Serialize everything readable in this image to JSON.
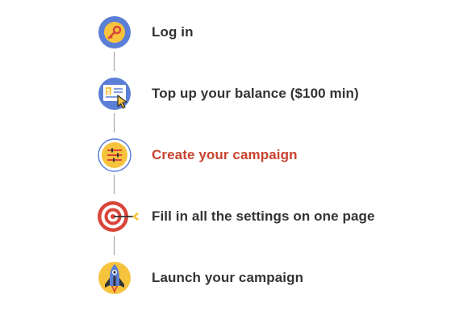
{
  "steps": [
    {
      "label": "Log in",
      "icon": "key-icon",
      "active": false
    },
    {
      "label": "Top up your balance ($100 min)",
      "icon": "payment-check-icon",
      "active": false
    },
    {
      "label": "Create your campaign",
      "icon": "settings-sliders-icon",
      "active": true
    },
    {
      "label": "Fill in all the settings on one page",
      "icon": "target-icon",
      "active": false
    },
    {
      "label": "Launch your campaign",
      "icon": "rocket-icon",
      "active": false
    }
  ],
  "colors": {
    "active_text": "#c8432e",
    "text": "#333333",
    "blue": "#5b7fd6",
    "yellow": "#f6c33c",
    "red": "#d9453a"
  }
}
